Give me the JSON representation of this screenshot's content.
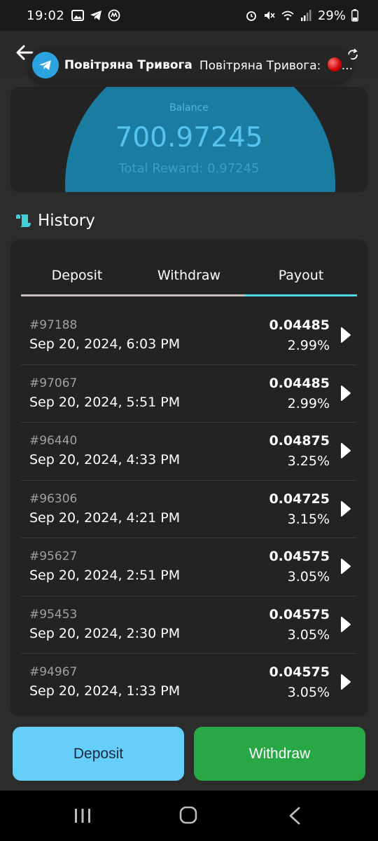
{
  "status_bar": {
    "time": "19:02",
    "battery": "29%",
    "left_icons": [
      "image-icon",
      "telegram-icon",
      "coin-app-icon"
    ],
    "right_icons": [
      "alarm-icon",
      "mute-icon",
      "wifi-icon",
      "signal-icon",
      "battery-icon"
    ]
  },
  "header": {
    "back_icon": "arrow-left-icon",
    "refresh_icon": "refresh-icon"
  },
  "notification": {
    "app": "Telegram",
    "title": "Повітряна Тривога",
    "body": "Повітряна Тривога:",
    "ellipsis": "...",
    "accent": "#2aa3e0"
  },
  "balance": {
    "label": "Balance",
    "value": "700.97245",
    "reward": "Total Reward: 0.97245",
    "accent": "#54c4ef"
  },
  "history": {
    "title": "History",
    "tabs": [
      {
        "label": "Deposit",
        "active": false
      },
      {
        "label": "Withdraw",
        "active": false
      },
      {
        "label": "Payout",
        "active": true
      }
    ],
    "active_color": "#4fd8e8",
    "rows": [
      {
        "id": "#97188",
        "date": "Sep 20, 2024, 6:03 PM",
        "amount": "0.04485",
        "percent": "2.99%"
      },
      {
        "id": "#97067",
        "date": "Sep 20, 2024, 5:51 PM",
        "amount": "0.04485",
        "percent": "2.99%"
      },
      {
        "id": "#96440",
        "date": "Sep 20, 2024, 4:33 PM",
        "amount": "0.04875",
        "percent": "3.25%"
      },
      {
        "id": "#96306",
        "date": "Sep 20, 2024, 4:21 PM",
        "amount": "0.04725",
        "percent": "3.15%"
      },
      {
        "id": "#95627",
        "date": "Sep 20, 2024, 2:51 PM",
        "amount": "0.04575",
        "percent": "3.05%"
      },
      {
        "id": "#95453",
        "date": "Sep 20, 2024, 2:30 PM",
        "amount": "0.04575",
        "percent": "3.05%"
      },
      {
        "id": "#94967",
        "date": "Sep 20, 2024, 1:33 PM",
        "amount": "0.04575",
        "percent": "3.05%"
      }
    ]
  },
  "actions": {
    "deposit_label": "Deposit",
    "withdraw_label": "Withdraw",
    "deposit_color": "#66cefb",
    "withdraw_color": "#28a745"
  },
  "nav": {
    "icons": [
      "recents-icon",
      "home-icon",
      "back-icon"
    ]
  }
}
